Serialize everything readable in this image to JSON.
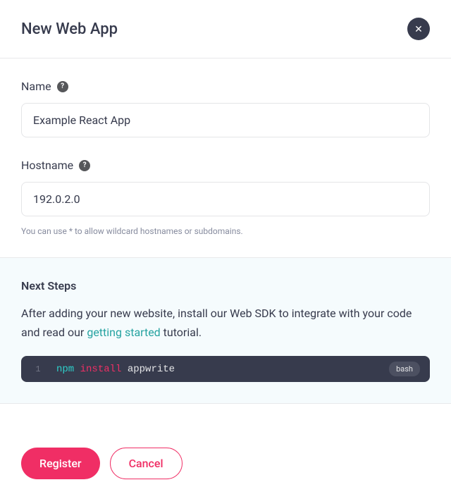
{
  "header": {
    "title": "New Web App"
  },
  "form": {
    "name": {
      "label": "Name",
      "value": "Example React App"
    },
    "hostname": {
      "label": "Hostname",
      "value": "192.0.2.0",
      "helper": "You can use * to allow wildcard hostnames or subdomains."
    }
  },
  "nextSteps": {
    "title": "Next Steps",
    "text_before": "After adding your new website, install our Web SDK to integrate with your code and read our ",
    "link_text": "getting started",
    "text_after": " tutorial.",
    "code": {
      "line_number": "1",
      "cmd": "npm",
      "action": "install",
      "pkg": "appwrite",
      "lang": "bash"
    }
  },
  "footer": {
    "register": "Register",
    "cancel": "Cancel"
  }
}
